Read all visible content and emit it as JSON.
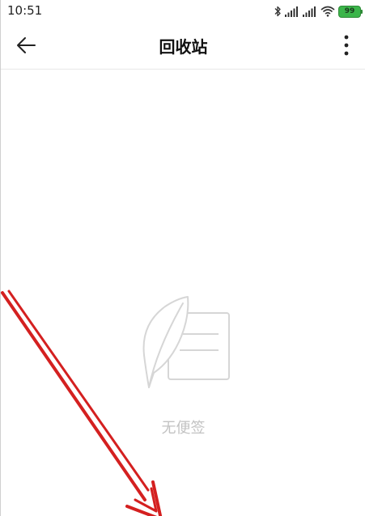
{
  "status_bar": {
    "time": "10:51",
    "battery_level": "99",
    "icons": [
      "bluetooth-icon",
      "signal-icon",
      "signal-icon",
      "wifi-icon",
      "battery-icon"
    ]
  },
  "header": {
    "title": "回收站",
    "back_icon": "back-arrow-icon",
    "more_icon": "more-vertical-icon"
  },
  "empty_state": {
    "icon": "feather-note-icon",
    "message": "无便签"
  },
  "colors": {
    "background": "#ffffff",
    "title": "#111111",
    "empty_text": "#c2c2c2",
    "battery": "#3bb54a",
    "annotation_arrow": "#d42020"
  }
}
